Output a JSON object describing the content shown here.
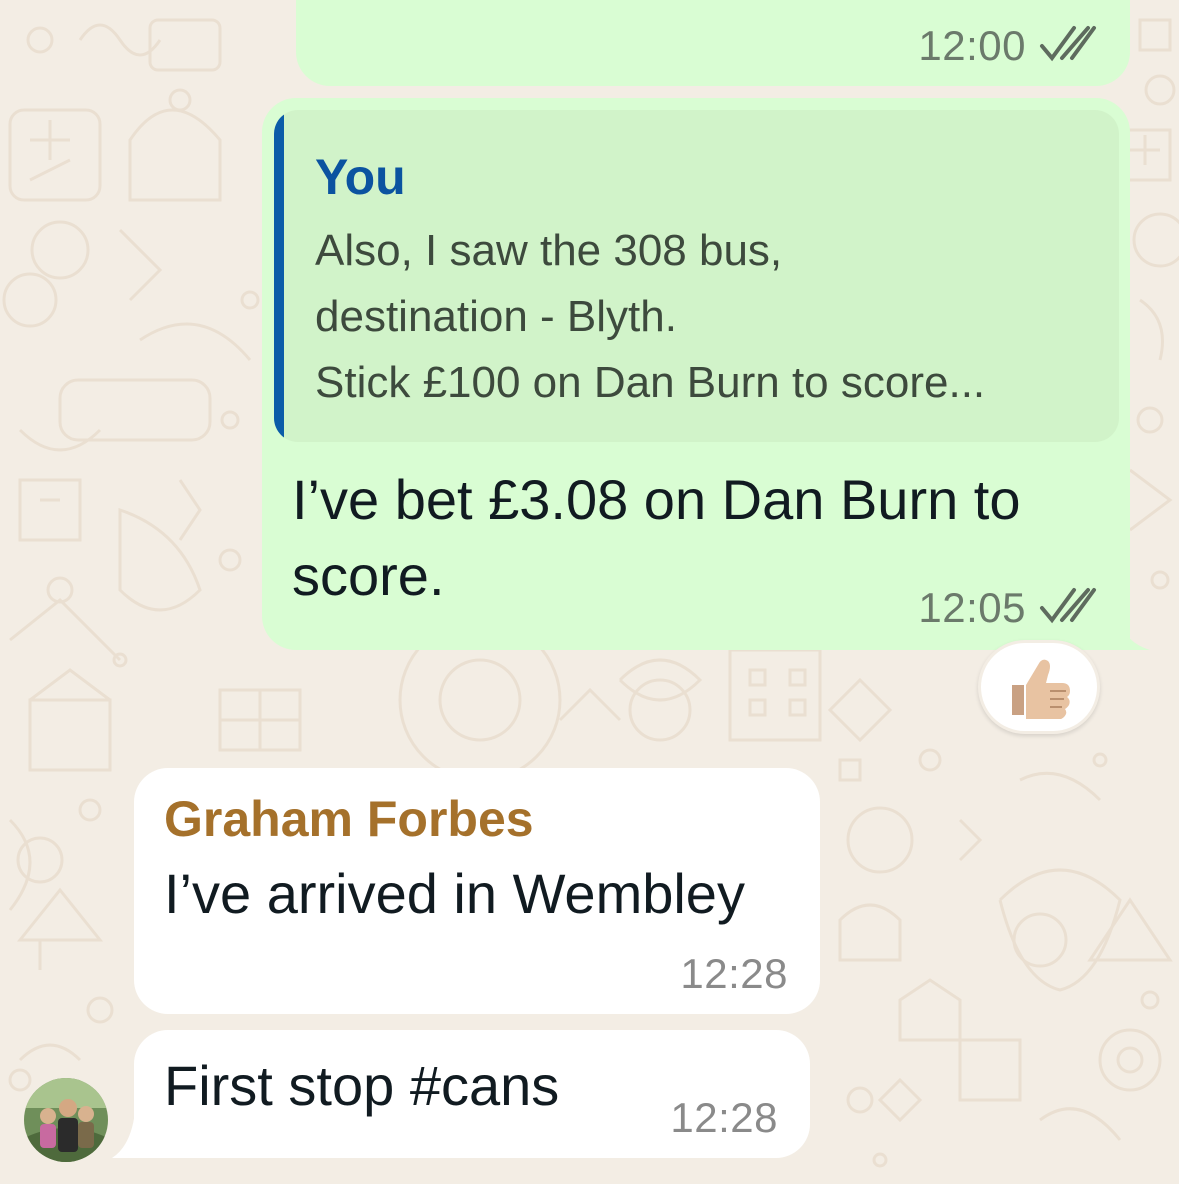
{
  "chat": {
    "messages": [
      {
        "direction": "outgoing",
        "time": "12:00",
        "status": "read",
        "status_icon": "double-check-icon"
      },
      {
        "direction": "outgoing",
        "quoted": {
          "sender": "You",
          "lines": [
            "Also, I saw the 308 bus,",
            "destination - Blyth.",
            "Stick £100 on Dan Burn to score..."
          ]
        },
        "text_lines": [
          "I’ve bet £3.08 on Dan Burn to",
          "score."
        ],
        "time": "12:05",
        "status": "read",
        "status_icon": "double-check-icon",
        "reaction": "👍🏼"
      },
      {
        "direction": "incoming",
        "sender": "Graham Forbes",
        "text": "I’ve arrived in Wembley",
        "time": "12:28"
      },
      {
        "direction": "incoming",
        "text": "First stop #cans",
        "time": "12:28",
        "avatar": "contact-avatar"
      }
    ]
  },
  "colors": {
    "wallpaper": "#f3ede4",
    "outgoing_bubble": "#d9fdd3",
    "incoming_bubble": "#ffffff",
    "quote_bar": "#0b5ca8",
    "quote_sender": "#0b53a0",
    "sender_name": "#a5712b",
    "read_ticks": "#6b7a6b"
  }
}
